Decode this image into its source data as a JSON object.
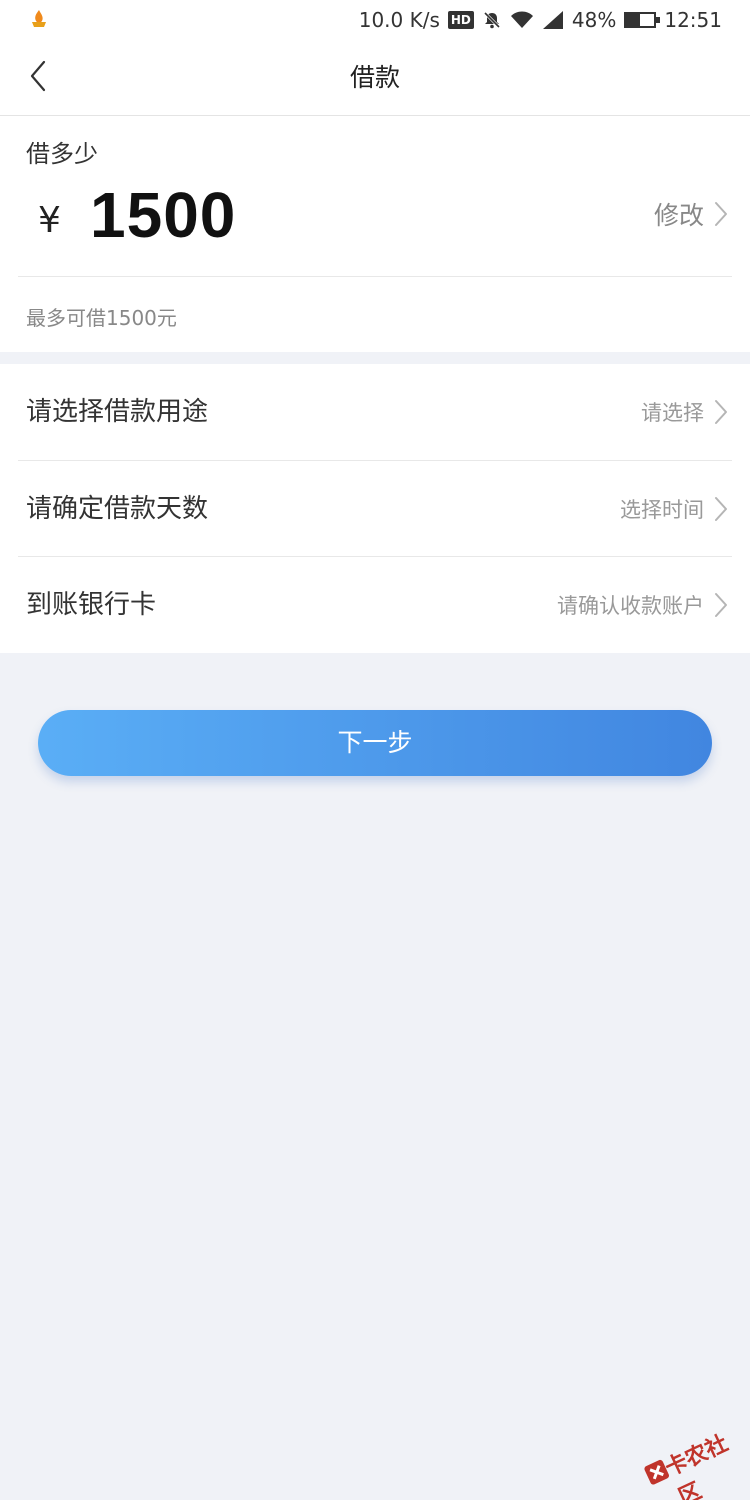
{
  "status_bar": {
    "speed": "10.0 K/s",
    "hd": "HD",
    "battery": "48%",
    "time": "12:51"
  },
  "nav": {
    "title": "借款"
  },
  "amount": {
    "label": "借多少",
    "currency": "¥",
    "value": "1500",
    "modify_label": "修改",
    "limit_text": "最多可借1500元"
  },
  "options": [
    {
      "label": "请选择借款用途",
      "value": "请选择"
    },
    {
      "label": "请确定借款天数",
      "value": "选择时间"
    },
    {
      "label": "到账银行卡",
      "value": "请确认收款账户"
    }
  ],
  "next_button": "下一步",
  "watermark": "卡农社区",
  "colors": {
    "page_bg": "#f0f2f7",
    "button_start": "#5aaef6",
    "button_end": "#4186e0"
  }
}
